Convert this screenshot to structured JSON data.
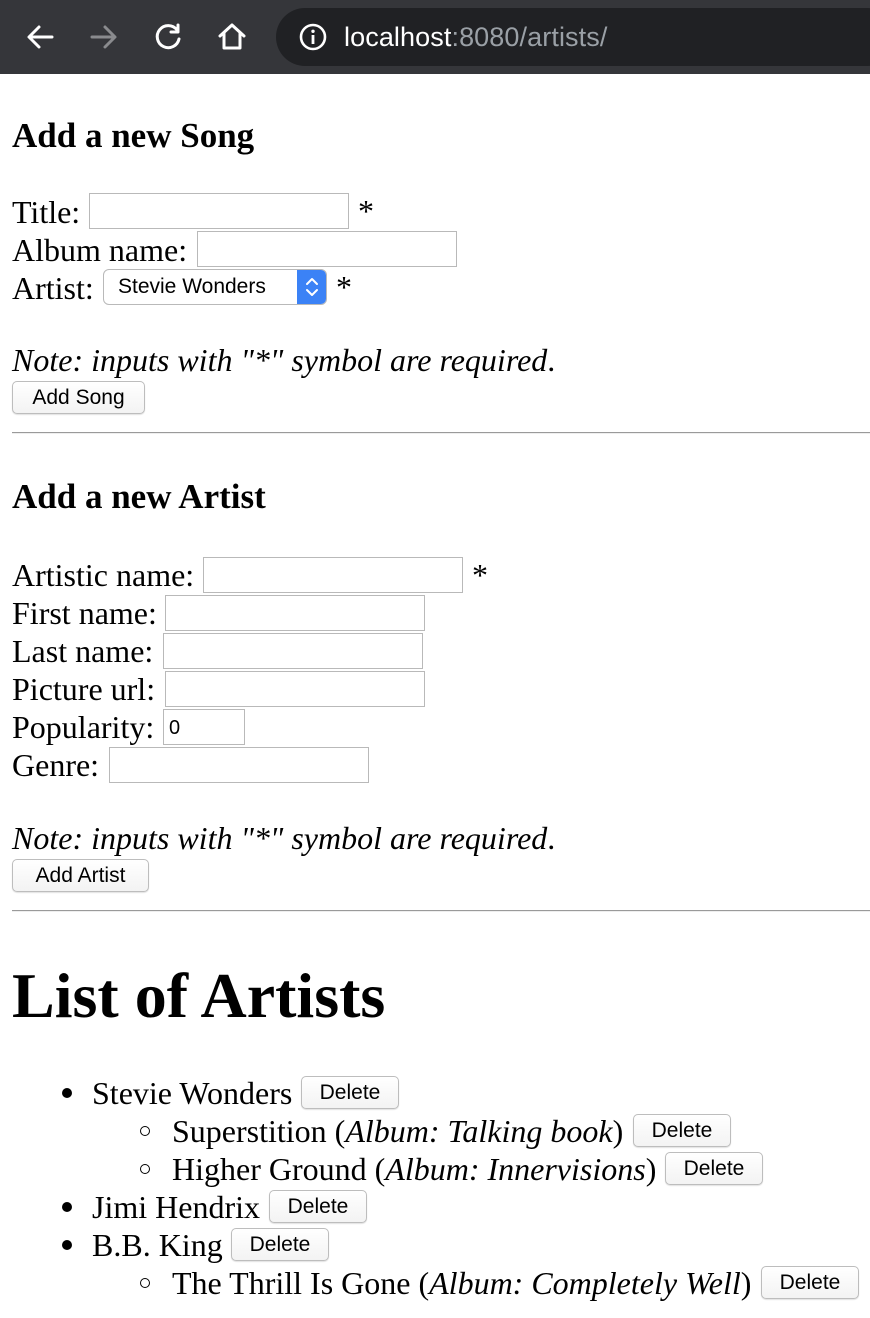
{
  "browser": {
    "url_host": "localhost",
    "url_rest": ":8080/artists/"
  },
  "song_form": {
    "heading": "Add a new Song",
    "title_label": "Title:",
    "title_value": "",
    "album_label": "Album name:",
    "album_value": "",
    "artist_label": "Artist:",
    "artist_selected": "Stevie Wonders",
    "required_mark": "*",
    "note_text": "Note: inputs with \"*\" symbol are required",
    "note_period": ".",
    "submit_label": "Add Song"
  },
  "artist_form": {
    "heading": "Add a new Artist",
    "artistic_name_label": "Artistic name:",
    "artistic_name_value": "",
    "first_name_label": "First name:",
    "first_name_value": "",
    "last_name_label": "Last name:",
    "last_name_value": "",
    "picture_url_label": "Picture url:",
    "picture_url_value": "",
    "popularity_label": "Popularity:",
    "popularity_value": "0",
    "genre_label": "Genre:",
    "genre_value": "",
    "required_mark": "*",
    "note_text": "Note: inputs with \"*\" symbol are required",
    "note_period": ".",
    "submit_label": "Add Artist"
  },
  "artists_list": {
    "heading": "List of Artists",
    "delete_label": "Delete",
    "artists": [
      {
        "name": "Stevie Wonders",
        "songs": [
          {
            "title": "Superstition",
            "album_prefix": "Album: ",
            "album": "Talking book"
          },
          {
            "title": "Higher Ground",
            "album_prefix": "Album: ",
            "album": "Innervisions"
          }
        ]
      },
      {
        "name": "Jimi Hendrix",
        "songs": []
      },
      {
        "name": "B.B. King",
        "songs": [
          {
            "title": "The Thrill Is Gone",
            "album_prefix": "Album: ",
            "album": "Completely Well"
          }
        ]
      }
    ]
  },
  "colors": {
    "toolbar_bg": "#35363a",
    "omnibox_bg": "#202124",
    "select_accent": "#3b82f6"
  }
}
